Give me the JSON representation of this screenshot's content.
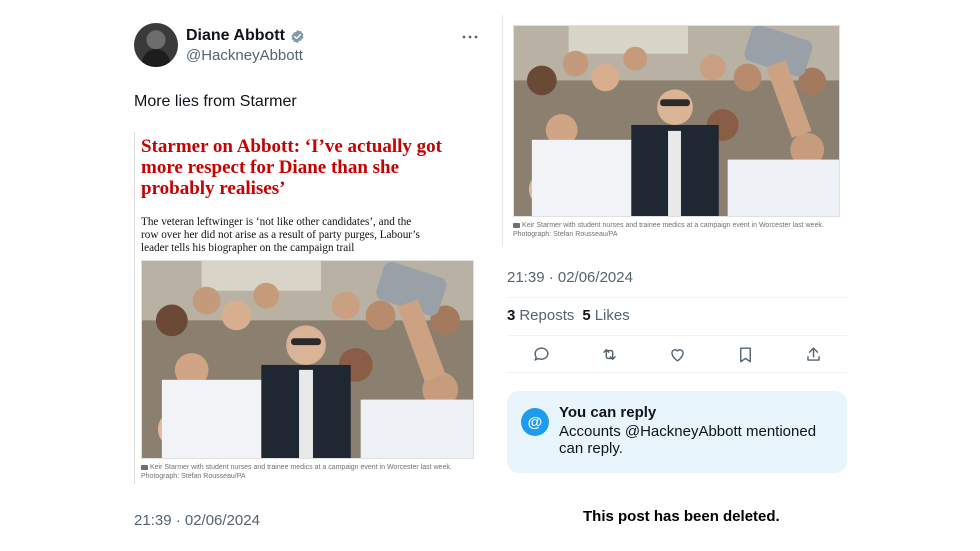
{
  "post": {
    "display_name": "Diane Abbott",
    "handle": "@HackneyAbbott",
    "text": "More lies from Starmer",
    "timestamp": "21:39 · 02/06/2024",
    "verified_icon": "verified-badge-icon",
    "more_icon": "more-dots-icon"
  },
  "article": {
    "headline": "Starmer on Abbott: ‘I’ve actually got more respect for Diane than she probably realises’",
    "standfirst": "The veteran leftwinger is ‘not like other candidates’, and the row over her did not arise as a result of party purges, Labour’s leader tells his biographer on the campaign trail",
    "caption": "Keir Starmer with student nurses and trainee medics at a campaign event in Worcester last week. Photograph: Stefan Rousseau/PA"
  },
  "right": {
    "caption": "Keir Starmer with student nurses and trainee medics at a campaign event in Worcester last week. Photograph: Stefan Rousseau/PA",
    "timestamp": "21:39 · 02/06/2024",
    "reposts_count": "3",
    "reposts_label": "Reposts",
    "likes_count": "5",
    "likes_label": "Likes",
    "actions": [
      "reply-icon",
      "repost-icon",
      "like-icon",
      "bookmark-icon",
      "share-icon"
    ],
    "reply_box": {
      "icon_glyph": "@",
      "title": "You can reply",
      "description": "Accounts @HackneyAbbott mentioned can reply."
    },
    "deleted_notice": "This post has been deleted."
  },
  "colors": {
    "headline_red": "#c70000",
    "link_blue": "#1d9bf0",
    "muted_text": "#536471",
    "reply_box_bg": "#e8f5fd"
  }
}
